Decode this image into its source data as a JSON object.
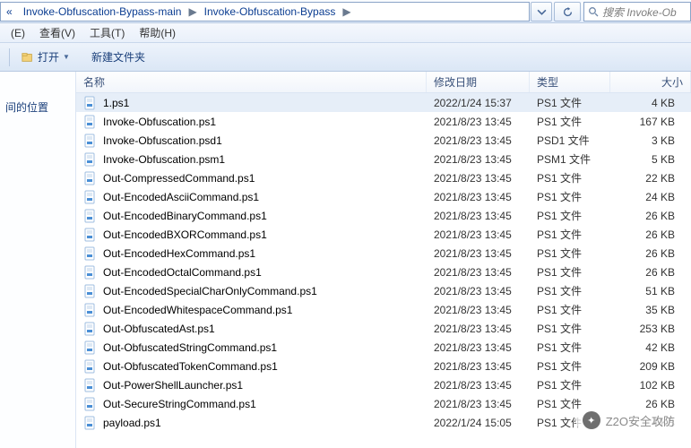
{
  "breadcrumb": {
    "seg1": "Invoke-Obfuscation-Bypass-main",
    "seg2": "Invoke-Obfuscation-Bypass"
  },
  "search": {
    "placeholder": "搜索 Invoke-Ob"
  },
  "menu": {
    "edit": "(E)",
    "view": "查看(V)",
    "tools": "工具(T)",
    "help": "帮助(H)"
  },
  "toolbar": {
    "open": "打开",
    "newfolder": "新建文件夹"
  },
  "nav": {
    "recent": "间的位置"
  },
  "columns": {
    "name": "名称",
    "date": "修改日期",
    "type": "类型",
    "size": "大小"
  },
  "files": [
    {
      "name": "1.ps1",
      "date": "2022/1/24 15:37",
      "type": "PS1 文件",
      "size": "4 KB",
      "selected": true
    },
    {
      "name": "Invoke-Obfuscation.ps1",
      "date": "2021/8/23 13:45",
      "type": "PS1 文件",
      "size": "167 KB",
      "selected": false
    },
    {
      "name": "Invoke-Obfuscation.psd1",
      "date": "2021/8/23 13:45",
      "type": "PSD1 文件",
      "size": "3 KB",
      "selected": false
    },
    {
      "name": "Invoke-Obfuscation.psm1",
      "date": "2021/8/23 13:45",
      "type": "PSM1 文件",
      "size": "5 KB",
      "selected": false
    },
    {
      "name": "Out-CompressedCommand.ps1",
      "date": "2021/8/23 13:45",
      "type": "PS1 文件",
      "size": "22 KB",
      "selected": false
    },
    {
      "name": "Out-EncodedAsciiCommand.ps1",
      "date": "2021/8/23 13:45",
      "type": "PS1 文件",
      "size": "24 KB",
      "selected": false
    },
    {
      "name": "Out-EncodedBinaryCommand.ps1",
      "date": "2021/8/23 13:45",
      "type": "PS1 文件",
      "size": "26 KB",
      "selected": false
    },
    {
      "name": "Out-EncodedBXORCommand.ps1",
      "date": "2021/8/23 13:45",
      "type": "PS1 文件",
      "size": "26 KB",
      "selected": false
    },
    {
      "name": "Out-EncodedHexCommand.ps1",
      "date": "2021/8/23 13:45",
      "type": "PS1 文件",
      "size": "26 KB",
      "selected": false
    },
    {
      "name": "Out-EncodedOctalCommand.ps1",
      "date": "2021/8/23 13:45",
      "type": "PS1 文件",
      "size": "26 KB",
      "selected": false
    },
    {
      "name": "Out-EncodedSpecialCharOnlyCommand.ps1",
      "date": "2021/8/23 13:45",
      "type": "PS1 文件",
      "size": "51 KB",
      "selected": false
    },
    {
      "name": "Out-EncodedWhitespaceCommand.ps1",
      "date": "2021/8/23 13:45",
      "type": "PS1 文件",
      "size": "35 KB",
      "selected": false
    },
    {
      "name": "Out-ObfuscatedAst.ps1",
      "date": "2021/8/23 13:45",
      "type": "PS1 文件",
      "size": "253 KB",
      "selected": false
    },
    {
      "name": "Out-ObfuscatedStringCommand.ps1",
      "date": "2021/8/23 13:45",
      "type": "PS1 文件",
      "size": "42 KB",
      "selected": false
    },
    {
      "name": "Out-ObfuscatedTokenCommand.ps1",
      "date": "2021/8/23 13:45",
      "type": "PS1 文件",
      "size": "209 KB",
      "selected": false
    },
    {
      "name": "Out-PowerShellLauncher.ps1",
      "date": "2021/8/23 13:45",
      "type": "PS1 文件",
      "size": "102 KB",
      "selected": false
    },
    {
      "name": "Out-SecureStringCommand.ps1",
      "date": "2021/8/23 13:45",
      "type": "PS1 文件",
      "size": "26 KB",
      "selected": false
    },
    {
      "name": "payload.ps1",
      "date": "2022/1/24 15:05",
      "type": "PS1 文件",
      "size": "4 KB",
      "selected": false
    }
  ],
  "watermark": {
    "text": "Z2O安全攻防"
  }
}
